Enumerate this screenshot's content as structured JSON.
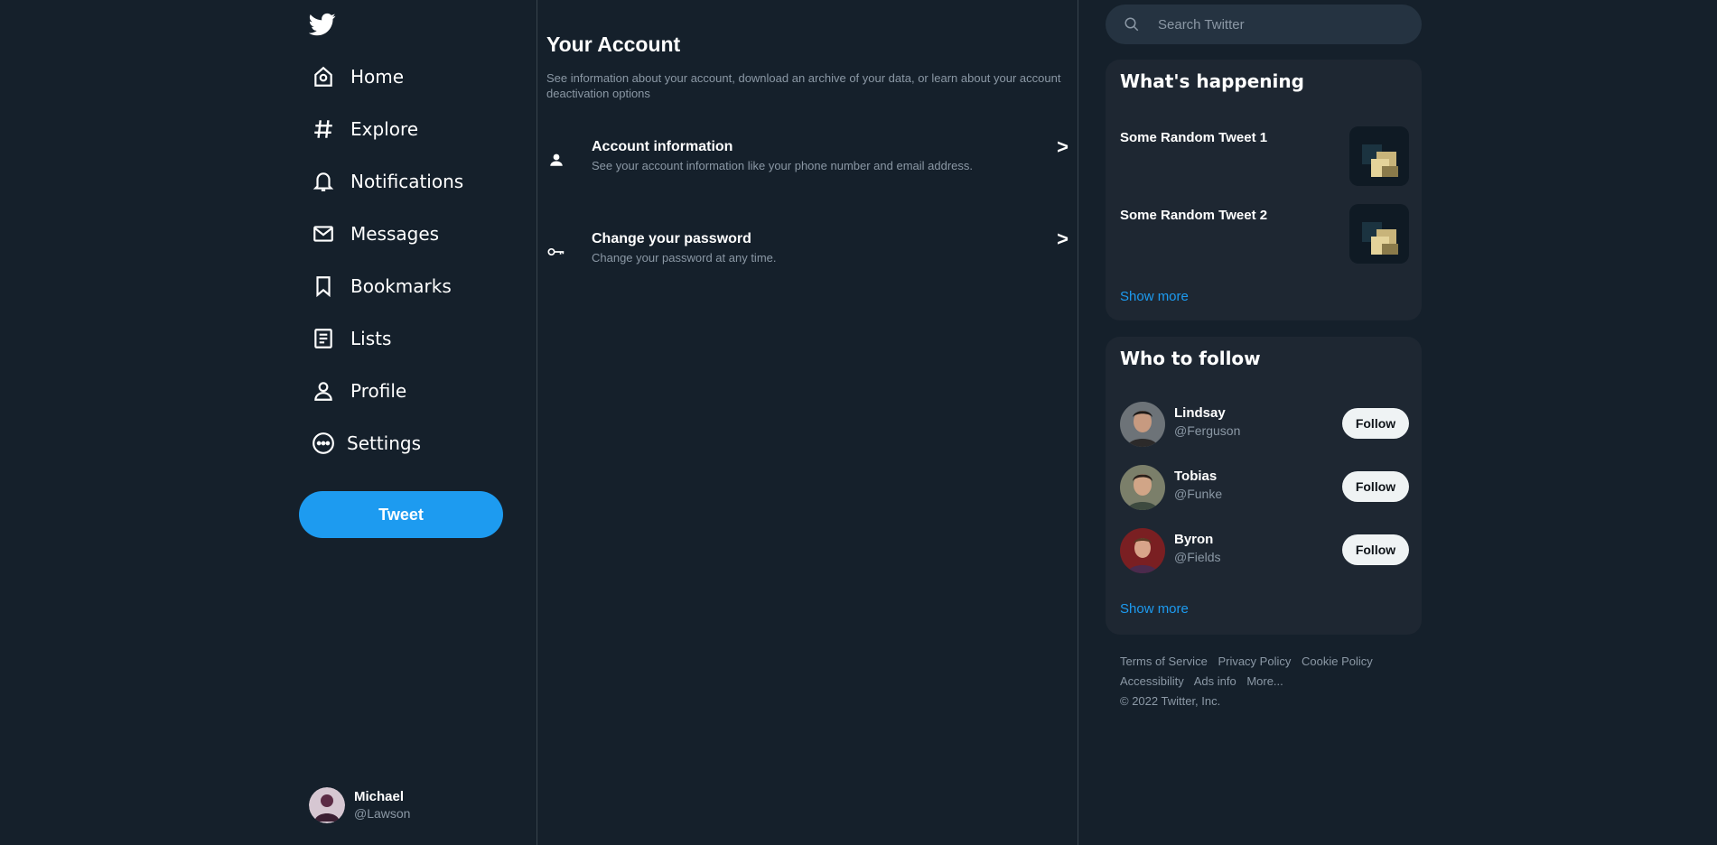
{
  "nav": {
    "items": [
      {
        "label": "Home",
        "icon": "home-icon"
      },
      {
        "label": "Explore",
        "icon": "hashtag-icon"
      },
      {
        "label": "Notifications",
        "icon": "bell-icon"
      },
      {
        "label": "Messages",
        "icon": "envelope-icon"
      },
      {
        "label": "Bookmarks",
        "icon": "bookmark-icon"
      },
      {
        "label": "Lists",
        "icon": "list-icon"
      },
      {
        "label": "Profile",
        "icon": "person-icon"
      },
      {
        "label": "Settings",
        "icon": "more-circle-icon"
      }
    ],
    "tweet_label": "Tweet"
  },
  "me": {
    "name": "Michael",
    "handle": "@Lawson"
  },
  "account": {
    "title": "Your Account",
    "description": "See information about your account, download an archive of your data, or learn about your account deactivation options",
    "rows": [
      {
        "title": "Account information",
        "subtitle": "See your account information like your phone number and email address.",
        "arrow": ">",
        "icon": "person-icon"
      },
      {
        "title": "Change your password",
        "subtitle": "Change your password at any time.",
        "arrow": ">",
        "icon": "key-icon"
      }
    ]
  },
  "search": {
    "placeholder": "Search Twitter"
  },
  "happening": {
    "title": "What's happening",
    "tweets": [
      {
        "text": "Some Random Tweet 1"
      },
      {
        "text": "Some Random Tweet 2"
      }
    ],
    "show_more": "Show more"
  },
  "who_to_follow": {
    "title": "Who to follow",
    "users": [
      {
        "name": "Lindsay",
        "handle": "@Ferguson",
        "button": "Follow"
      },
      {
        "name": "Tobias",
        "handle": "@Funke",
        "button": "Follow"
      },
      {
        "name": "Byron",
        "handle": "@Fields",
        "button": "Follow"
      }
    ],
    "show_more": "Show more"
  },
  "footer": {
    "links": [
      "Terms of Service",
      "Privacy Policy",
      "Cookie Policy",
      "Accessibility",
      "Ads info",
      "More..."
    ],
    "copyright": "© 2022 Twitter, Inc."
  },
  "colors": {
    "background": "#15202b",
    "card": "#1e2732",
    "accent": "#1d9bf0",
    "muted_text": "#8b98a5",
    "divider": "#38444d"
  }
}
